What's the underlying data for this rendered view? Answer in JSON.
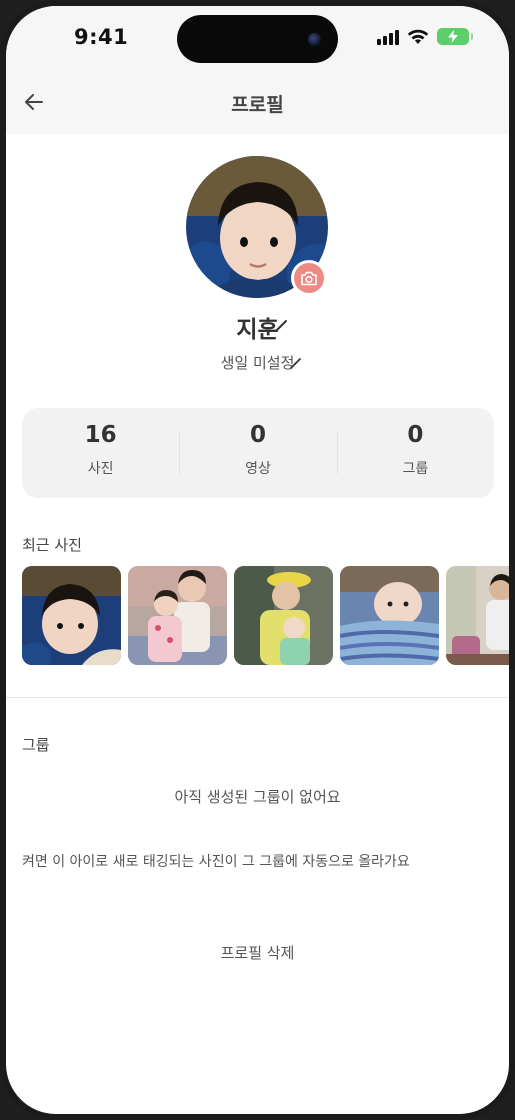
{
  "status_bar": {
    "time": "9:41",
    "icons": [
      "cellular-signal-icon",
      "wifi-icon",
      "battery-charging-icon"
    ],
    "battery_color": "#5ccf6b"
  },
  "header": {
    "title": "프로필",
    "back_icon": "arrow-left-icon"
  },
  "profile": {
    "name": "지훈",
    "birthday": "생일 미설정",
    "camera_icon": "camera-icon",
    "edit_icon": "pencil-icon",
    "camera_color": "#ee8a84"
  },
  "stats": [
    {
      "value": "16",
      "label": "사진"
    },
    {
      "value": "0",
      "label": "영상"
    },
    {
      "value": "0",
      "label": "그룹"
    }
  ],
  "recent_photos": {
    "title": "최근 사진",
    "photos": [
      "child-with-blanket",
      "two-children-on-sofa",
      "woman-with-baby",
      "baby-on-blanket",
      "woman-indoors"
    ]
  },
  "groups": {
    "title": "그룹",
    "empty_text": "아직 생성된 그룹이 없어요",
    "hint": "켜면 이 아이로 새로 태깅되는 사진이 그 그룹에 자동으로 올라가요"
  },
  "delete_profile_label": "프로필 삭제"
}
